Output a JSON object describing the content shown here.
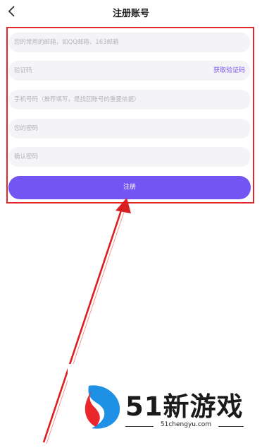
{
  "header": {
    "title": "注册账号",
    "back_icon": "chevron-left-icon"
  },
  "form": {
    "email_placeholder": "您的常用的邮箱，如QQ邮箱、163邮箱",
    "code_placeholder": "验证码",
    "get_code_label": "获取验证码",
    "phone_placeholder": "手机号码（推荐填写，是找回账号的重要依据）",
    "password_placeholder": "您的密码",
    "confirm_password_placeholder": "确认密码",
    "register_label": "注册"
  },
  "watermark": {
    "brand": "51新游戏",
    "url": "51chengyu.com"
  },
  "colors": {
    "accent": "#7355f4",
    "annotation_red": "#e0282a",
    "field_bg": "#f4f4f6"
  }
}
